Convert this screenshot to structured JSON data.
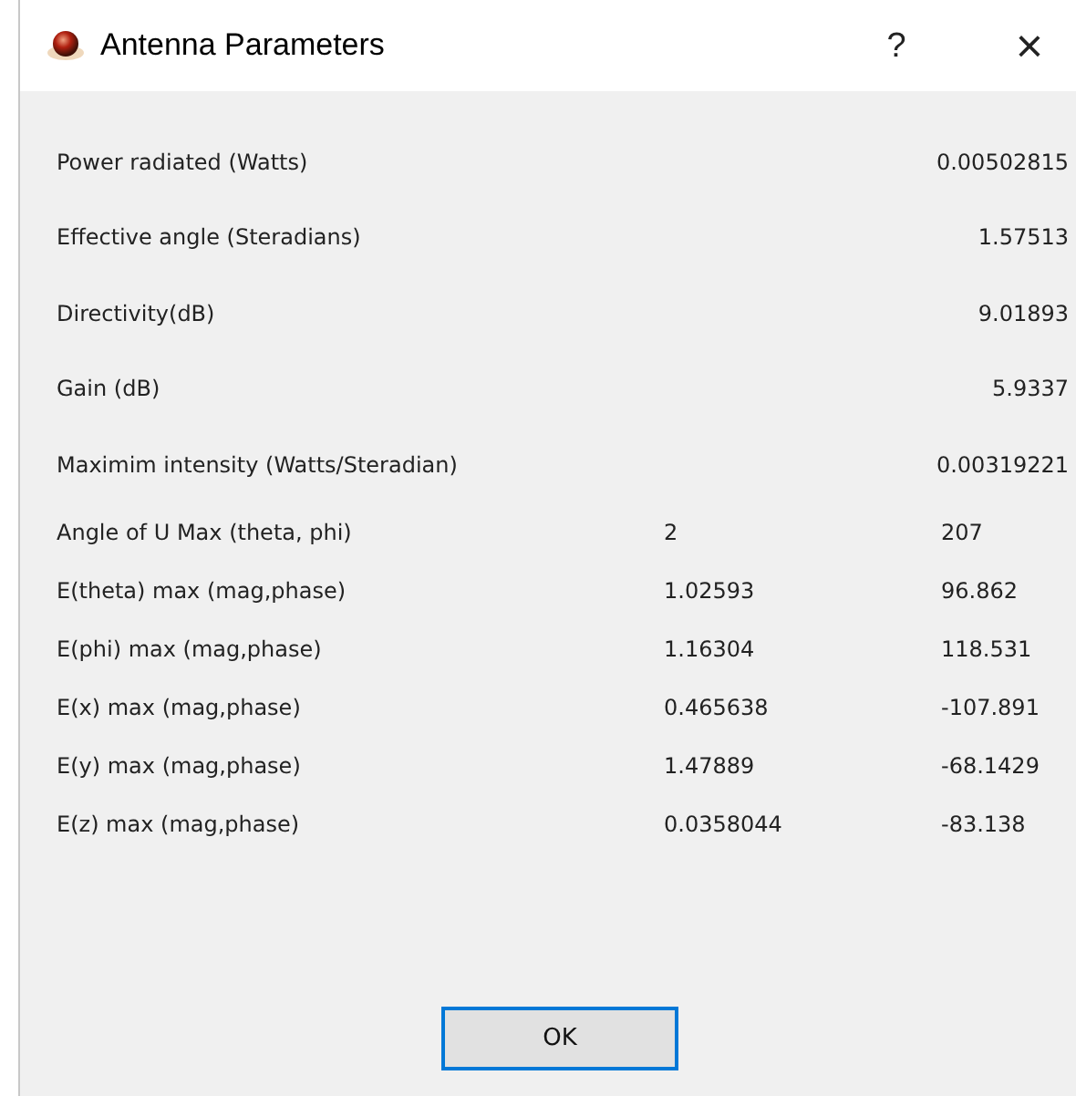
{
  "window": {
    "title": "Antenna Parameters",
    "help": "?",
    "close": "×"
  },
  "rows": [
    {
      "kind": "single",
      "label": "Power radiated (Watts)",
      "values": [
        "0.00502815"
      ]
    },
    {
      "kind": "single",
      "label": "Effective angle (Steradians)",
      "values": [
        "1.57513"
      ]
    },
    {
      "kind": "single",
      "label": "Directivity(dB)",
      "values": [
        "9.01893"
      ]
    },
    {
      "kind": "single",
      "label": "Gain (dB)",
      "values": [
        "5.9337"
      ]
    },
    {
      "kind": "single",
      "label": "Maximim intensity (Watts/Steradian)",
      "values": [
        "0.00319221"
      ]
    },
    {
      "kind": "pair",
      "label": "Angle of U Max (theta, phi)",
      "values": [
        "2",
        "207"
      ]
    },
    {
      "kind": "pair",
      "label": "E(theta) max (mag,phase)",
      "values": [
        "1.02593",
        "96.862"
      ]
    },
    {
      "kind": "pair",
      "label": "E(phi) max (mag,phase)",
      "values": [
        "1.16304",
        "118.531"
      ]
    },
    {
      "kind": "pair",
      "label": "E(x) max (mag,phase)",
      "values": [
        "0.465638",
        "-107.891"
      ]
    },
    {
      "kind": "pair",
      "label": "E(y) max (mag,phase)",
      "values": [
        "1.47889",
        "-68.1429"
      ]
    },
    {
      "kind": "pair",
      "label": "E(z) max (mag,phase)",
      "values": [
        "0.0358044",
        "-83.138"
      ]
    }
  ],
  "buttons": [
    {
      "label": "OK",
      "selected": true
    }
  ]
}
